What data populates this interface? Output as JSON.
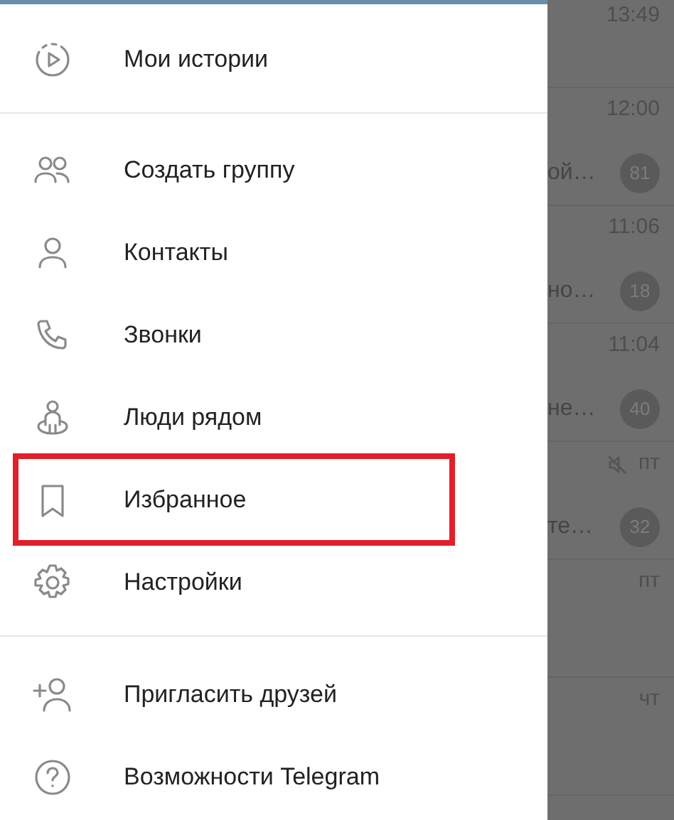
{
  "drawer": {
    "top_items": [
      {
        "kind": "stories",
        "label": "Мои истории"
      }
    ],
    "items": [
      {
        "kind": "group",
        "label": "Создать группу",
        "highlighted": false
      },
      {
        "kind": "contact",
        "label": "Контакты",
        "highlighted": false
      },
      {
        "kind": "phone",
        "label": "Звонки",
        "highlighted": false
      },
      {
        "kind": "nearby",
        "label": "Люди рядом",
        "highlighted": false
      },
      {
        "kind": "bookmark",
        "label": "Избранное",
        "highlighted": true
      },
      {
        "kind": "gear",
        "label": "Настройки",
        "highlighted": false
      }
    ],
    "bottom_items": [
      {
        "kind": "invite",
        "label": "Пригласить друзей"
      },
      {
        "kind": "help",
        "label": "Возможности Telegram"
      }
    ]
  },
  "chats": [
    {
      "time": "13:49"
    },
    {
      "time": "12:00",
      "snippet": "ой…",
      "unread": "81"
    },
    {
      "time": "11:06",
      "snippet": "но…",
      "unread": "18"
    },
    {
      "time": "11:04",
      "snippet": "не…",
      "unread": "40"
    },
    {
      "time": "пт",
      "snippet": "те…",
      "unread": "32",
      "muted": true
    },
    {
      "time": "пт"
    },
    {
      "time": "чт"
    }
  ]
}
